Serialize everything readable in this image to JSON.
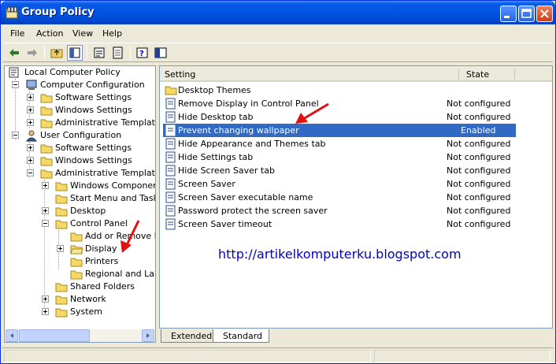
{
  "window": {
    "title": "Group Policy"
  },
  "menu": [
    "File",
    "Action",
    "View",
    "Help"
  ],
  "tree": [
    {
      "label": "Local Computer Policy"
    },
    {
      "label": "Computer Configuration"
    },
    {
      "label": "Software Settings"
    },
    {
      "label": "Windows Settings"
    },
    {
      "label": "Administrative Templates"
    },
    {
      "label": "User Configuration"
    },
    {
      "label": "Software Settings"
    },
    {
      "label": "Windows Settings"
    },
    {
      "label": "Administrative Templates"
    },
    {
      "label": "Windows Components"
    },
    {
      "label": "Start Menu and Taskbar"
    },
    {
      "label": "Desktop"
    },
    {
      "label": "Control Panel"
    },
    {
      "label": "Add or Remove Programs"
    },
    {
      "label": "Display"
    },
    {
      "label": "Printers"
    },
    {
      "label": "Regional and Language Options"
    },
    {
      "label": "Shared Folders"
    },
    {
      "label": "Network"
    },
    {
      "label": "System"
    }
  ],
  "list": {
    "columns": {
      "setting": "Setting",
      "state": "State"
    },
    "rows": [
      {
        "name": "Desktop Themes",
        "state": ""
      },
      {
        "name": "Remove Display in Control Panel",
        "state": "Not configured"
      },
      {
        "name": "Hide Desktop tab",
        "state": "Not configured"
      },
      {
        "name": "Prevent changing wallpaper",
        "state": "Enabled"
      },
      {
        "name": "Hide Appearance and Themes tab",
        "state": "Not configured"
      },
      {
        "name": "Hide Settings tab",
        "state": "Not configured"
      },
      {
        "name": "Hide Screen Saver tab",
        "state": "Not configured"
      },
      {
        "name": "Screen Saver",
        "state": "Not configured"
      },
      {
        "name": "Screen Saver executable name",
        "state": "Not configured"
      },
      {
        "name": "Password protect the screen saver",
        "state": "Not configured"
      },
      {
        "name": "Screen Saver timeout",
        "state": "Not configured"
      }
    ]
  },
  "watermark": "http://artikelkomputerku.blogspot.com",
  "tabs": {
    "extended": "Extended",
    "standard": "Standard"
  },
  "colors": {
    "titlebar": "#0054e3",
    "selection": "#316ac5",
    "link": "#0000cc",
    "annotation": "#e01010"
  }
}
